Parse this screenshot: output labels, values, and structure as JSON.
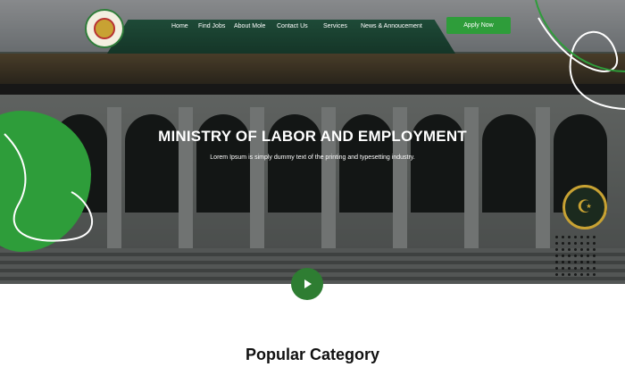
{
  "brand": {
    "logo_icon": "ministry-seal-icon"
  },
  "nav": {
    "items": [
      "Home",
      "Find Jobs",
      "About Mole",
      "Contact Us",
      "Services",
      "News & Annoucement"
    ]
  },
  "header": {
    "apply_label": "Apply Now"
  },
  "hero": {
    "title": "MINISTRY OF LABOR AND EMPLOYMENT",
    "subtitle": "Lorem Ipsum is simply dummy text of the printing and typesetting industry.",
    "play_icon": "play-icon"
  },
  "section": {
    "title": "Popular Category"
  },
  "colors": {
    "accent": "#2e9d3a",
    "play": "#2e7d32",
    "text": "#111111"
  }
}
